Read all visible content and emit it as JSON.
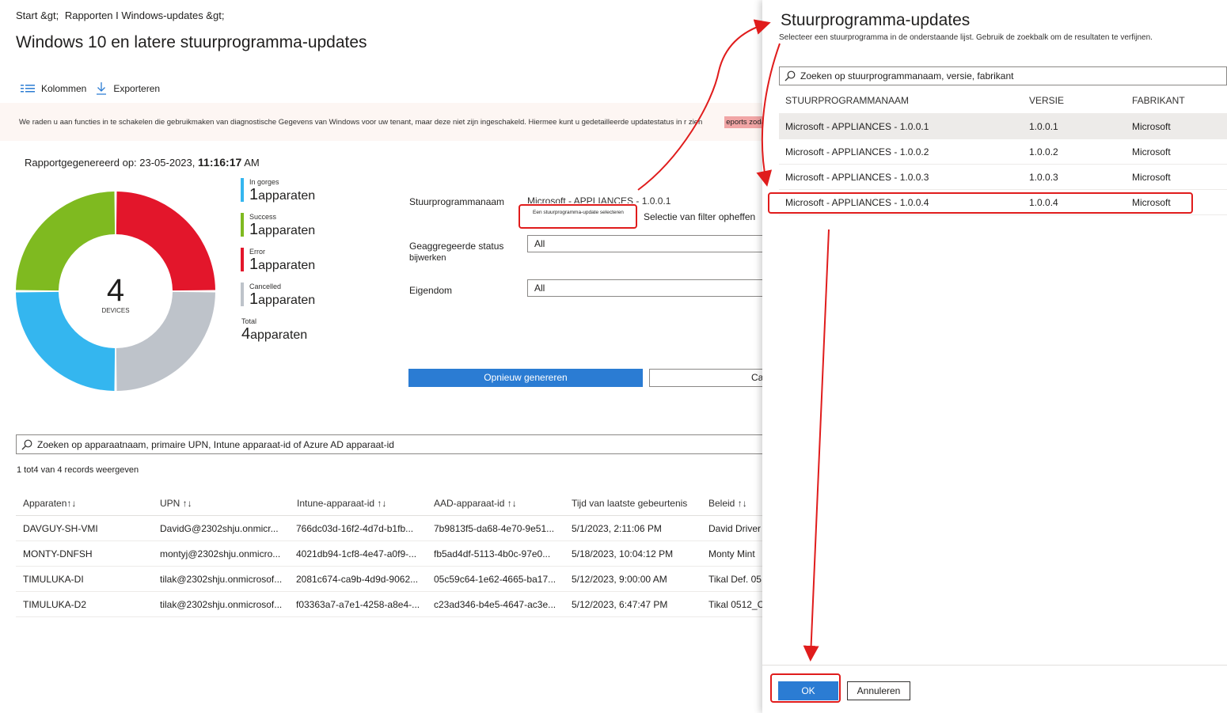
{
  "breadcrumb": {
    "start": "Start &gt;",
    "reports": "Rapporten I Windows-updates &gt;"
  },
  "page_title": "Windows 10 en latere stuurprogramma-updates",
  "toolbar": {
    "columns": "Kolommen",
    "export": "Exporteren"
  },
  "warning": {
    "text": "We raden u aan functies in te schakelen die gebruikmaken van diagnostische Gegevens van Windows voor uw tenant, maar deze niet zijn ingeschakeld. Hiermee kunt u gedetailleerde updatestatus in r zien",
    "highlight": "eports zodat u"
  },
  "generated": {
    "label": "Rapportgegenereerd op: 23-05-2023,",
    "time": "11:16:17",
    "ampm": "AM"
  },
  "donut": {
    "total": "4",
    "caption": "DEVICES",
    "segments": [
      {
        "name": "Error",
        "value": 1,
        "color": "#e3162b"
      },
      {
        "name": "Cancelled",
        "value": 1,
        "color": "#bec3ca"
      },
      {
        "name": "In gorges",
        "value": 1,
        "color": "#34b6ef"
      },
      {
        "name": "Success",
        "value": 1,
        "color": "#7fba20"
      }
    ]
  },
  "legend": [
    {
      "label": "In gorges",
      "n": "1",
      "unit": "apparaten",
      "color": "#34b6ef"
    },
    {
      "label": "Success",
      "n": "1",
      "unit": "apparaten",
      "color": "#7fba20"
    },
    {
      "label": "Error",
      "n": "1",
      "unit": "apparaten",
      "color": "#e3162b"
    },
    {
      "label": "Cancelled",
      "n": "1",
      "unit": "apparaten",
      "color": "#bec3ca"
    },
    {
      "label": "Total",
      "n": "4",
      "unit": "apparaten",
      "color": ""
    }
  ],
  "filters": {
    "driver_label": "Stuurprogrammanaam",
    "driver_value": "Microsoft - APPLIANCES - 1.0.0.1",
    "select_link": "Een stuurprogramma-update selecteren",
    "clear_link": "Selectie van filter opheffen",
    "status_label_1": "Geaggregeerde status",
    "status_label_2": "bijwerken",
    "status_value": "All",
    "ownership_label": "Eigendom",
    "ownership_value": "All",
    "regenerate": "Opnieuw genereren",
    "cancel_partial": "Ca"
  },
  "device_search": {
    "placeholder": "Zoeken op apparaatnaam, primaire UPN, Intune apparaat-id of Azure AD apparaat-id"
  },
  "records": "1 tot4 van 4 records weergeven",
  "device_table": {
    "headers": [
      "Apparaten↑↓",
      "UPN ↑↓",
      "Intune-apparaat-id ↑↓",
      "AAD-apparaat-id ↑↓",
      "Tijd van laatste gebeurtenis",
      "Beleid ↑↓"
    ],
    "rows": [
      [
        "DAVGUY-SH-VMI",
        "DavidG@2302shju.onmicr...",
        "766dc03d-16f2-4d7d-b1fb...",
        "7b9813f5-da68-4e70-9e51...",
        "5/1/2023, 2:11:06 PM",
        "David Driver"
      ],
      [
        "MONTY-DNFSH",
        "montyj@2302shju.onmicro...",
        "4021db94-1cf8-4e47-a0f9-...",
        "fb5ad4df-5113-4b0c-97e0...",
        "5/18/2023, 10:04:12 PM",
        "Monty Mint"
      ],
      [
        "TIMULUKA-DI",
        "tilak@2302shju.onmicrosof...",
        "2081c674-ca9b-4d9d-9062...",
        "05c59c64-1e62-4665-ba17...",
        "5/12/2023, 9:00:00 AM",
        "Tikal Def. 05"
      ],
      [
        "TIMULUKA-D2",
        "tilak@2302shju.onmicrosof...",
        "f03363a7-a7e1-4258-a8e4-...",
        "c23ad346-b4e5-4647-ac3e...",
        "5/12/2023, 6:47:47 PM",
        "Tikal 0512_C"
      ]
    ]
  },
  "flyout": {
    "title": "Stuurprogramma-updates",
    "subtitle": "Selecteer een stuurprogramma in de onderstaande lijst. Gebruik de zoekbalk om de resultaten te verfijnen.",
    "search_placeholder": "Zoeken op stuurprogrammanaam, versie, fabrikant",
    "headers": [
      "STUURPROGRAMMANAAM",
      "VERSIE",
      "FABRIKANT"
    ],
    "rows": [
      [
        "Microsoft   - APPLIANCES - 1.0.0.1",
        "1.0.0.1",
        "Microsoft"
      ],
      [
        "Microsoft   - APPLIANCES - 1.0.0.2",
        "1.0.0.2",
        "Microsoft"
      ],
      [
        "Microsoft   - APPLIANCES - 1.0.0.3",
        "1.0.0.3",
        "Microsoft"
      ],
      [
        "Microsoft   - APPLIANCES - 1.0.0.4",
        "1.0.0.4",
        "Microsoft"
      ]
    ],
    "ok": "OK",
    "cancel": "Annuleren"
  },
  "colors": {
    "accent": "#2b7cd3",
    "annotation": "#e01c1c",
    "warning": "#f7a11a"
  }
}
